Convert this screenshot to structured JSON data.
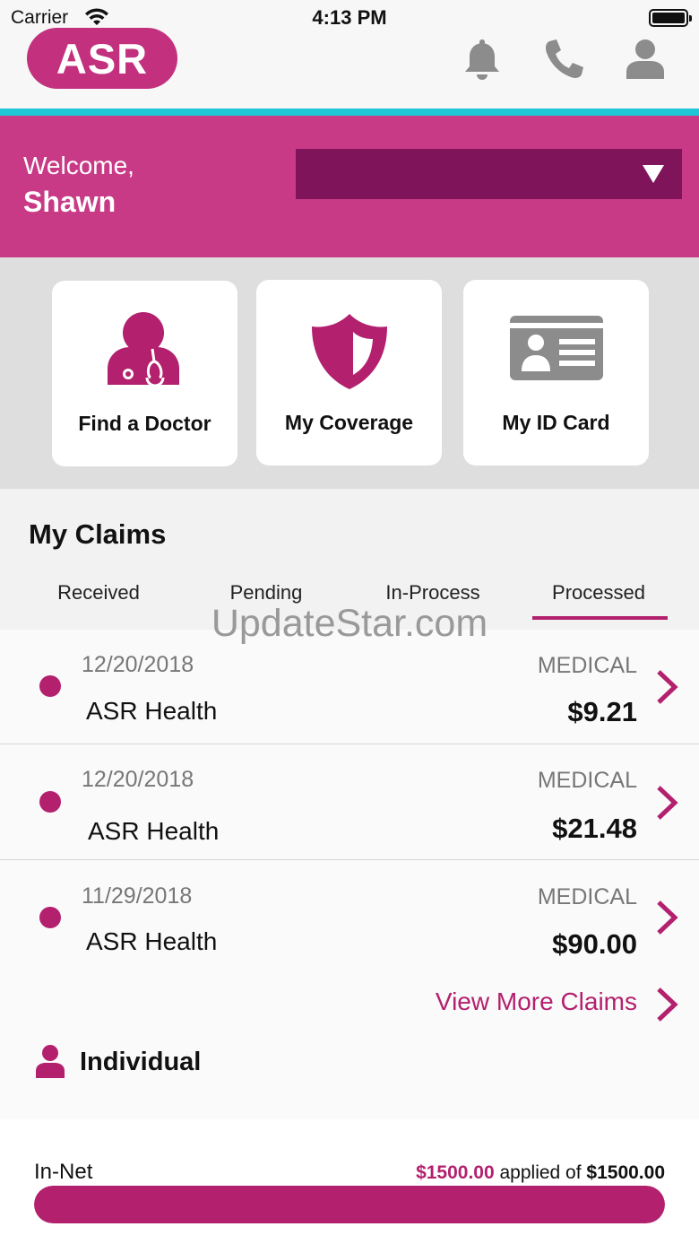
{
  "status_bar": {
    "carrier": "Carrier",
    "time": "4:13 PM"
  },
  "header": {
    "logo_text": "ASR",
    "icons": [
      "bell-icon",
      "phone-icon",
      "user-icon"
    ]
  },
  "welcome": {
    "greeting": "Welcome,",
    "name": "Shawn",
    "plan_selector_value": ""
  },
  "quick_actions": [
    {
      "label": "Find a Doctor",
      "icon": "doctor-icon"
    },
    {
      "label": "My Coverage",
      "icon": "shield-icon"
    },
    {
      "label": "My ID Card",
      "icon": "id-card-icon"
    }
  ],
  "claims": {
    "title": "My Claims",
    "tabs": [
      "Received",
      "Pending",
      "In-Process",
      "Processed"
    ],
    "active_tab": "Processed",
    "items": [
      {
        "date": "12/20/2018",
        "provider": "ASR Health",
        "type": "MEDICAL",
        "amount": "$9.21"
      },
      {
        "date": "12/20/2018",
        "provider": "ASR Health",
        "type": "MEDICAL",
        "amount": "$21.48"
      },
      {
        "date": "11/29/2018",
        "provider": "ASR Health",
        "type": "MEDICAL",
        "amount": "$90.00"
      }
    ],
    "view_more": "View More Claims"
  },
  "watermark": "UpdateStar.com",
  "coverage": {
    "section_label": "Individual",
    "network_label": "In-Net",
    "applied_amount": "$1500.00",
    "applied_text": " applied of ",
    "total_amount": "$1500.00",
    "progress": 1.0
  },
  "colors": {
    "brand": "#c2307e",
    "brand_dark": "#7f145b",
    "accent_teal": "#1fc7d6",
    "tile_icon_gray": "#8c8c8c"
  }
}
